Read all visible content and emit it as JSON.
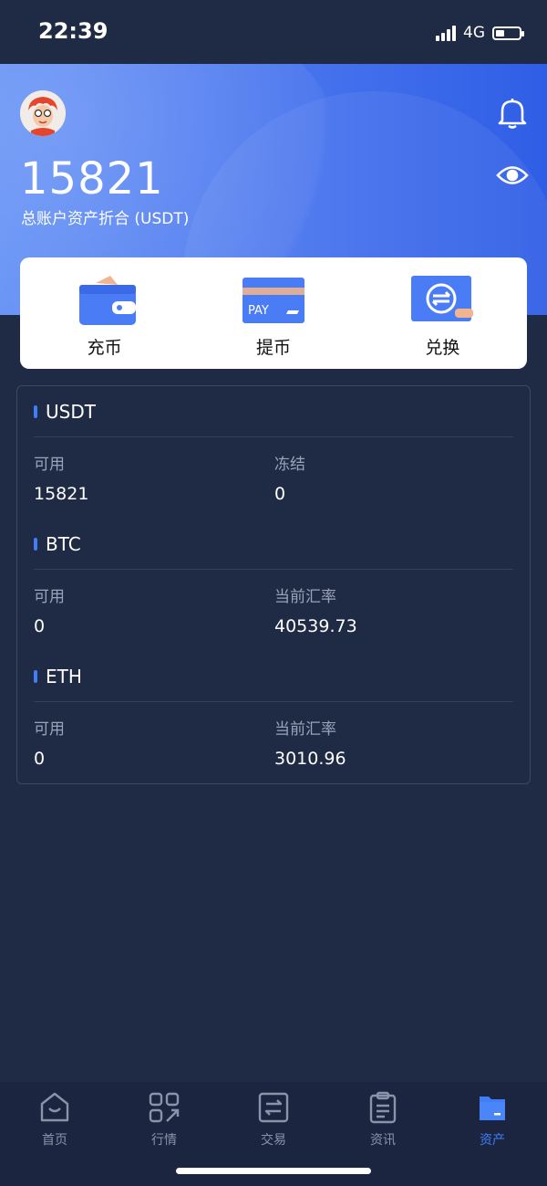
{
  "status_bar": {
    "time": "22:39",
    "network": "4G"
  },
  "header": {
    "total_amount": "15821",
    "total_label": "总账户资产折合 (USDT)"
  },
  "actions": [
    {
      "label": "充币",
      "icon": "wallet-icon"
    },
    {
      "label": "提币",
      "icon": "pay-card-icon"
    },
    {
      "label": "兑换",
      "icon": "exchange-icon"
    }
  ],
  "assets": [
    {
      "coin": "USDT",
      "left_label": "可用",
      "left_value": "15821",
      "right_label": "冻结",
      "right_value": "0"
    },
    {
      "coin": "BTC",
      "left_label": "可用",
      "left_value": "0",
      "right_label": "当前汇率",
      "right_value": "40539.73"
    },
    {
      "coin": "ETH",
      "left_label": "可用",
      "left_value": "0",
      "right_label": "当前汇率",
      "right_value": "3010.96"
    }
  ],
  "nav": [
    {
      "label": "首页",
      "icon": "home-icon",
      "active": false
    },
    {
      "label": "行情",
      "icon": "market-icon",
      "active": false
    },
    {
      "label": "交易",
      "icon": "trade-icon",
      "active": false
    },
    {
      "label": "资讯",
      "icon": "news-icon",
      "active": false
    },
    {
      "label": "资产",
      "icon": "assets-icon",
      "active": true
    }
  ],
  "colors": {
    "accent": "#3f7ef7",
    "background": "#1f2a44",
    "hero_start": "#5d8cf5",
    "hero_end": "#2f5ee6"
  }
}
